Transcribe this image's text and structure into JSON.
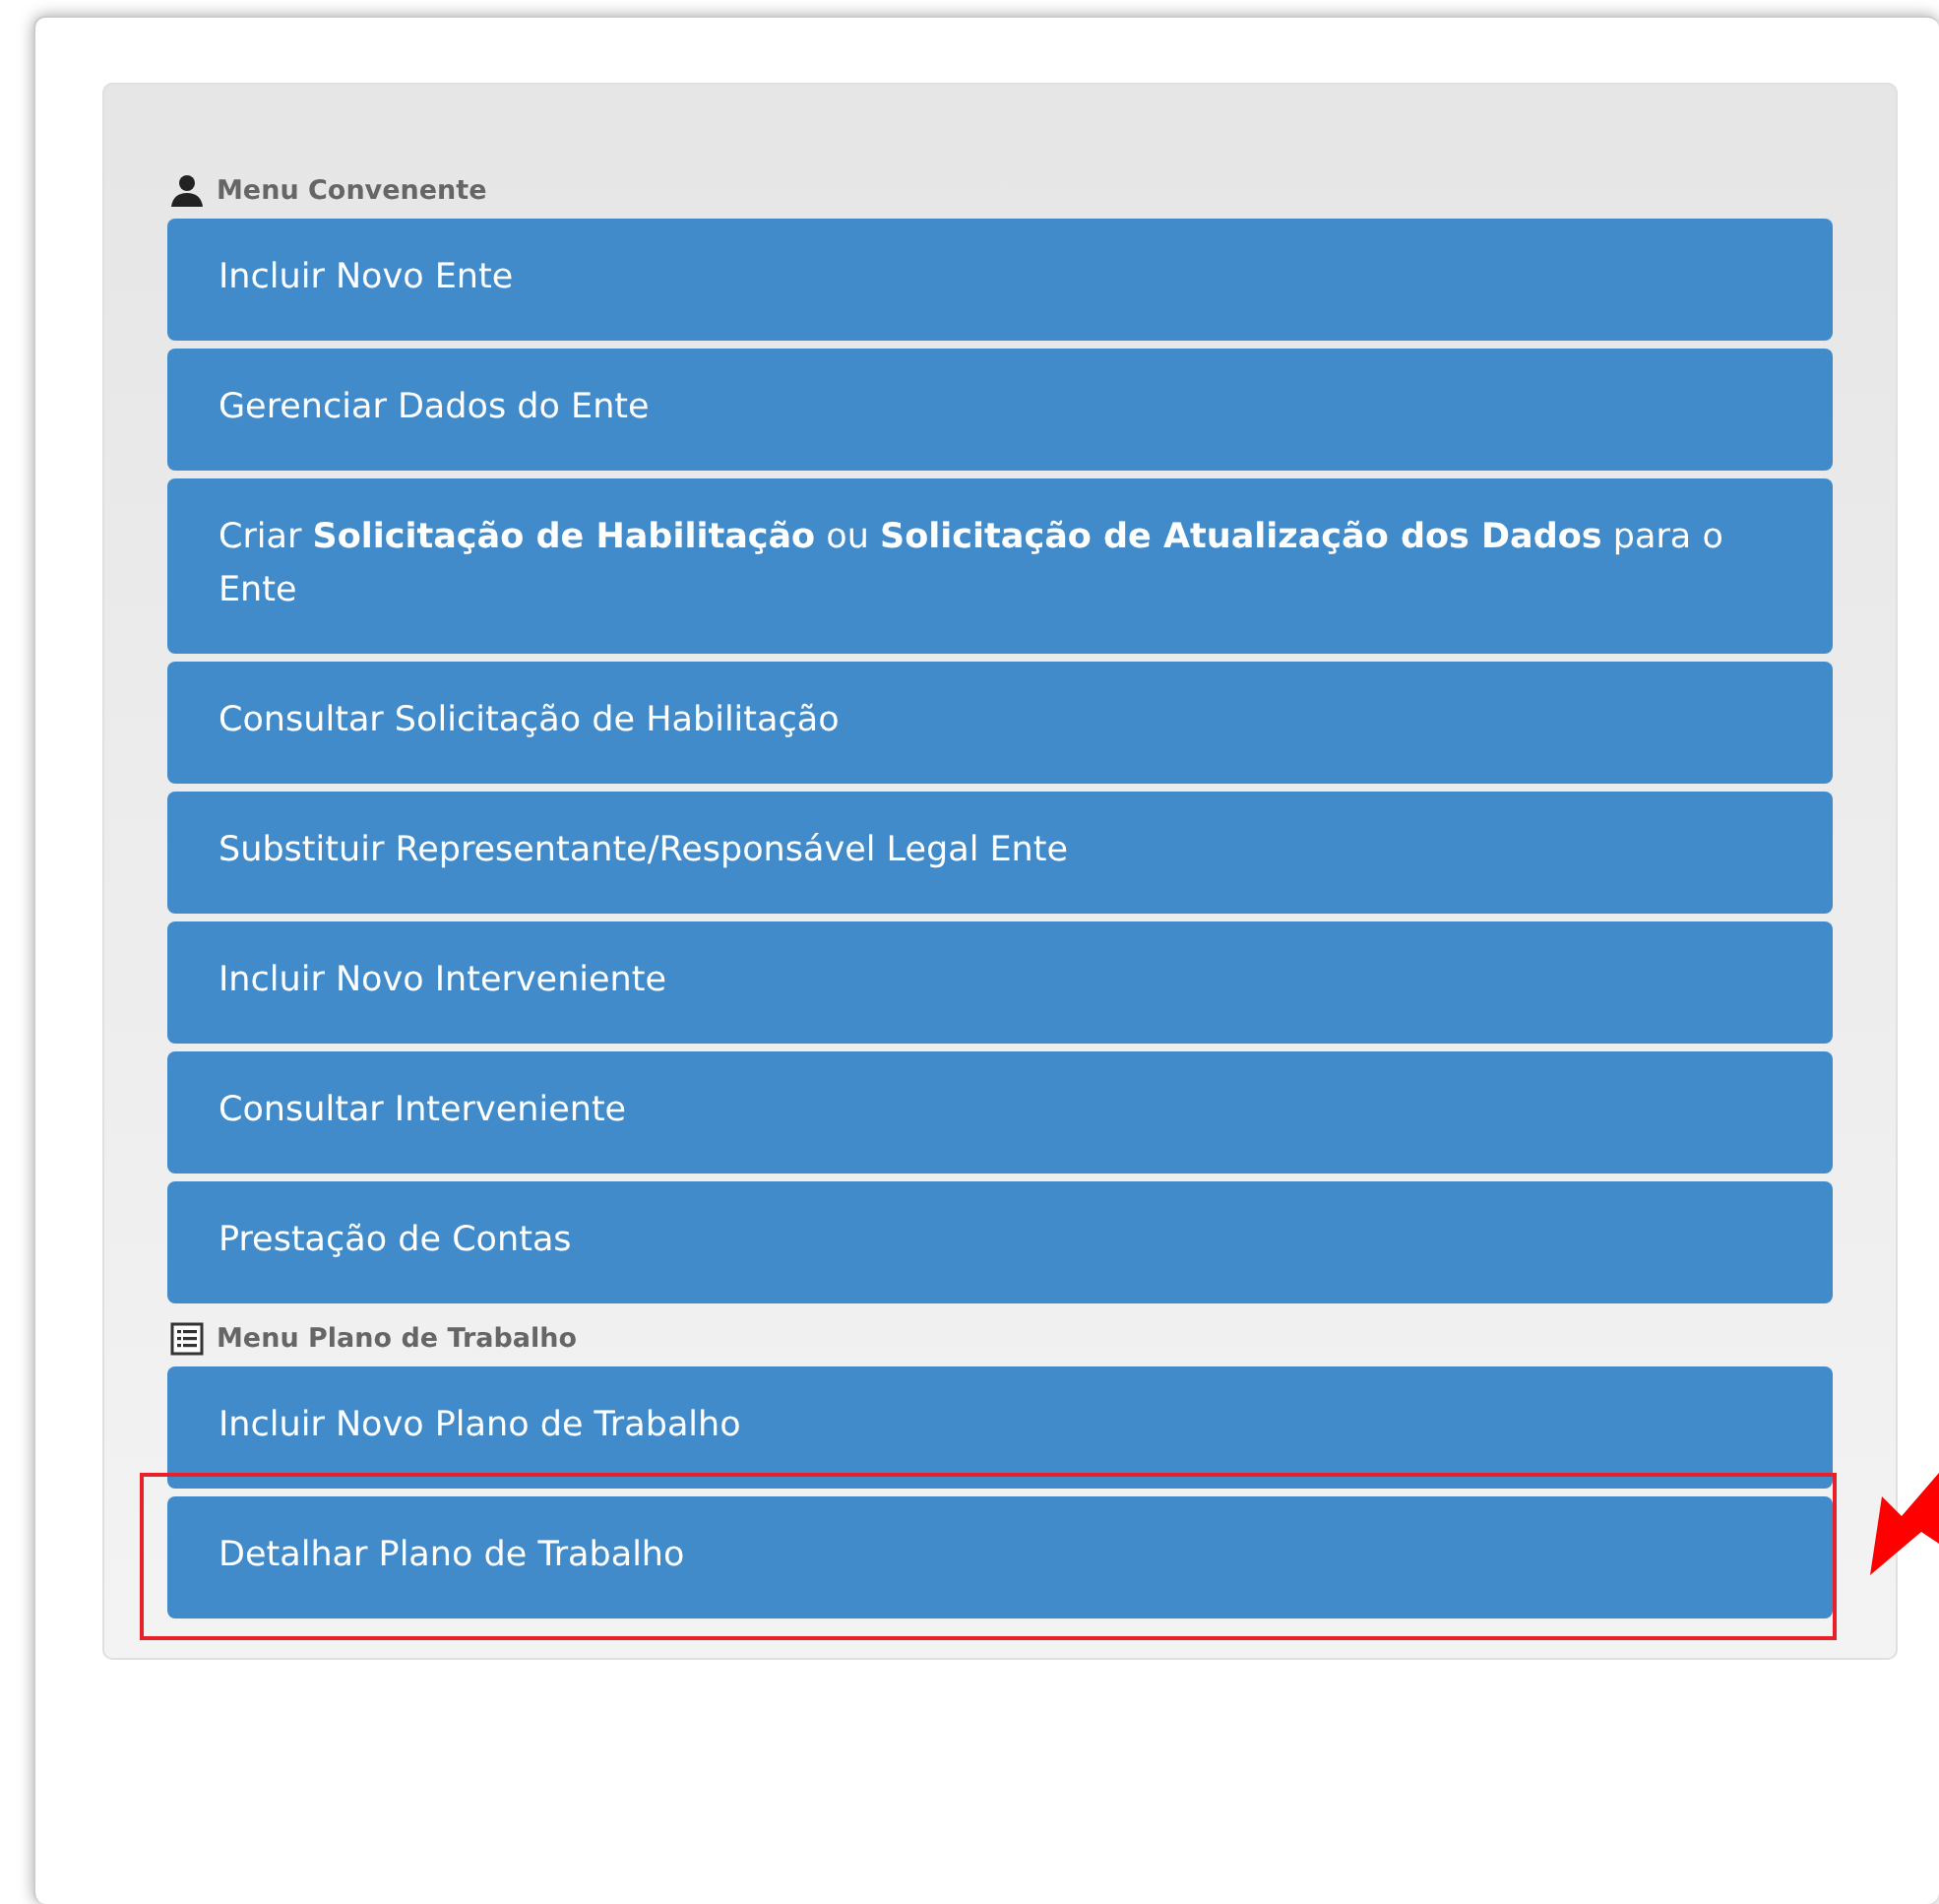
{
  "sections": [
    {
      "title": "Menu Convenente",
      "items": [
        {
          "label": "Incluir Novo Ente",
          "highlighted": false
        },
        {
          "label": "Gerenciar Dados do Ente",
          "highlighted": false
        },
        {
          "label": "Criar **Solicitação de Habilitação** ou **Solicitação de Atualização dos Dados** para o Ente",
          "highlighted": false
        },
        {
          "label": "Consultar Solicitação de Habilitação",
          "highlighted": false
        },
        {
          "label": "Substituir Representante/Responsável Legal Ente",
          "highlighted": false
        },
        {
          "label": "Incluir Novo Interveniente",
          "highlighted": false
        },
        {
          "label": "Consultar Interveniente",
          "highlighted": false
        },
        {
          "label": "Prestação de Contas",
          "highlighted": false
        }
      ]
    },
    {
      "title": "Menu Plano de Trabalho",
      "items": [
        {
          "label": "Incluir Novo Plano de Trabalho",
          "highlighted": false
        },
        {
          "label": "Detalhar Plano de Trabalho",
          "highlighted": true
        }
      ]
    }
  ]
}
